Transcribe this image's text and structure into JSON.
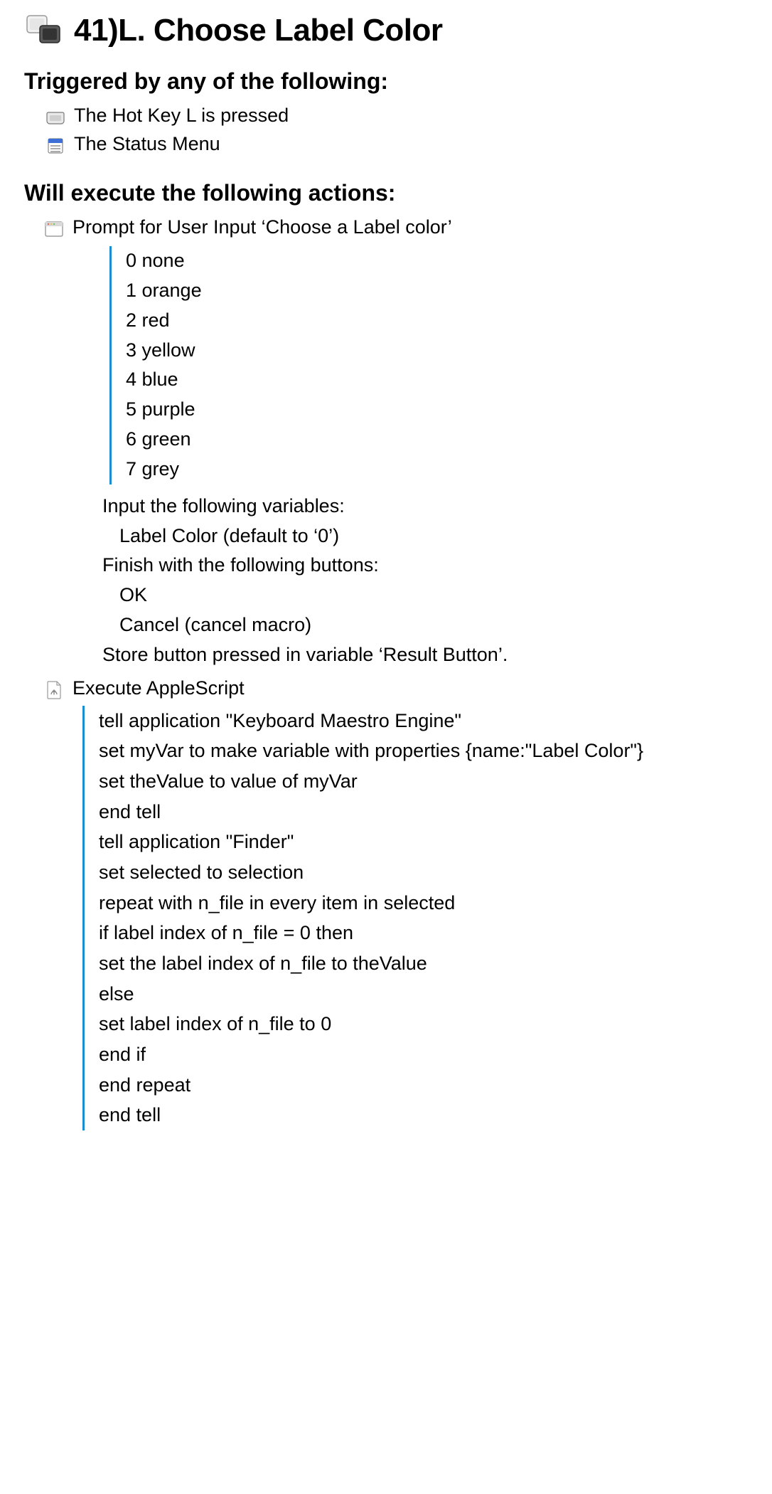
{
  "title": "41)L. Choose Label Color",
  "triggers_heading": "Triggered by any of the following:",
  "triggers": [
    "The Hot Key L is pressed",
    "The Status Menu"
  ],
  "actions_heading": "Will execute the following actions:",
  "action_prompt": {
    "title": "Prompt for User Input ‘Choose a Label color’",
    "options": [
      "0 none",
      "1 orange",
      "2 red",
      "3 yellow",
      "4 blue",
      "5 purple",
      "6 green",
      "7 grey"
    ],
    "input_label": "Input the following variables:",
    "input_variable": "Label Color (default to ‘0’)",
    "finish_label": "Finish with the following buttons:",
    "finish_buttons": [
      "OK",
      "Cancel (cancel macro)"
    ],
    "store_label": "Store button pressed in variable ‘Result Button’."
  },
  "action_script": {
    "title": "Execute AppleScript",
    "lines": [
      "tell application \"Keyboard Maestro Engine\"",
      "set myVar to make variable with properties {name:\"Label Color\"}",
      "set theValue to value of myVar",
      "end tell",
      "tell application \"Finder\"",
      "set selected to selection",
      "repeat with n_file in every item in selected",
      "if label index of n_file = 0 then",
      "set the label index of n_file to theValue",
      "else",
      "set label index of n_file to 0",
      "end if",
      "end repeat",
      "end tell"
    ]
  }
}
